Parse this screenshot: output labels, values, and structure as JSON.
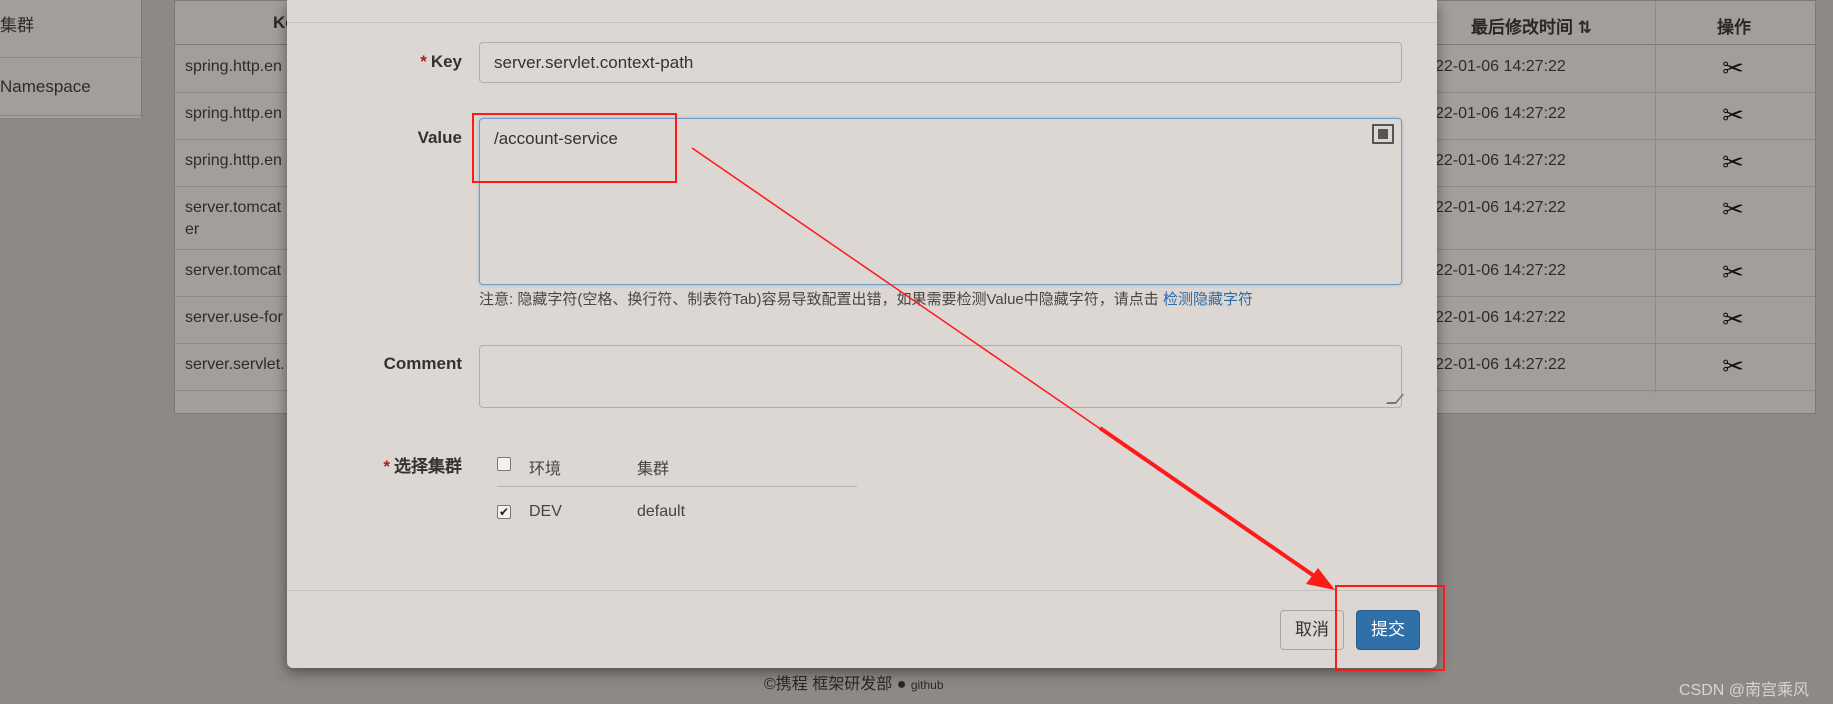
{
  "background": {
    "nav_items": [
      "集群",
      "Namespace"
    ],
    "table_headers": {
      "key": "Ke",
      "modified_time": "最后修改时间",
      "sort_icon": "sort-icon",
      "operation": "操作"
    },
    "rows": [
      {
        "key": "spring.http.en",
        "time": "22-01-06 14:27:22"
      },
      {
        "key": "spring.http.en",
        "time": "22-01-06 14:27:22"
      },
      {
        "key": "spring.http.en",
        "time": "22-01-06 14:27:22"
      },
      {
        "key": "server.tomcat",
        "key2": "er",
        "time": "22-01-06 14:27:22"
      },
      {
        "key": "server.tomcat",
        "time": "22-01-06 14:27:22"
      },
      {
        "key": "server.use-for",
        "time": "22-01-06 14:27:22"
      },
      {
        "key": "server.servlet.",
        "time": "22-01-06 14:27:22"
      }
    ],
    "footer": "©携程 框架研发部",
    "footer_github": "github",
    "watermark": "CSDN @南宫乘风"
  },
  "modal": {
    "key_label": "Key",
    "key_value": "server.servlet.context-path",
    "value_label": "Value",
    "value_value": "/account-service",
    "hint": "注意: 隐藏字符(空格、换行符、制表符Tab)容易导致配置出错，如果需要检测Value中隐藏字符，请点击",
    "hint_link": "检测隐藏字符",
    "comment_label": "Comment",
    "comment_value": "",
    "cluster_label": "选择集群",
    "cluster_table": {
      "headers": {
        "env": "环境",
        "cluster": "集群"
      },
      "rows": [
        {
          "checked": true,
          "env": "DEV",
          "cluster": "default"
        }
      ]
    },
    "cancel_label": "取消",
    "submit_label": "提交"
  },
  "colors": {
    "annotation": "#ff1a1a",
    "primary_button": "#3070a8",
    "link": "#2c6aa5"
  }
}
